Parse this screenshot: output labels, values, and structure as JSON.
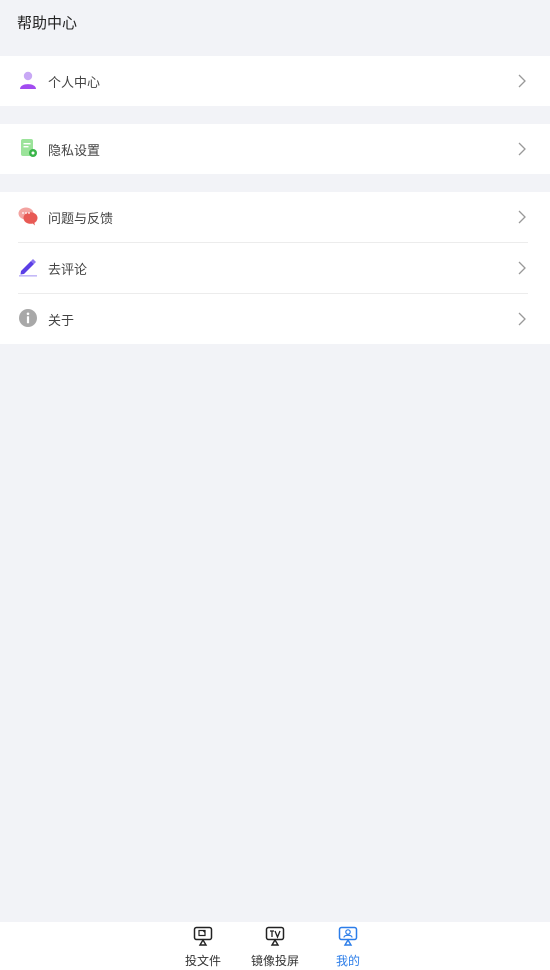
{
  "header": {
    "title": "帮助中心"
  },
  "groups": [
    {
      "items": [
        {
          "label": "个人中心",
          "icon": "person-icon"
        }
      ]
    },
    {
      "items": [
        {
          "label": "隐私设置",
          "icon": "privacy-doc-icon"
        }
      ]
    },
    {
      "items": [
        {
          "label": "问题与反馈",
          "icon": "chat-bubbles-icon"
        },
        {
          "label": "去评论",
          "icon": "pen-icon"
        },
        {
          "label": "关于",
          "icon": "info-icon"
        }
      ]
    }
  ],
  "tabbar": {
    "tabs": [
      {
        "label": "投文件",
        "icon": "cast-file-icon",
        "active": false
      },
      {
        "label": "镜像投屏",
        "icon": "screen-mirror-tv-icon",
        "active": false
      },
      {
        "label": "我的",
        "icon": "profile-cast-icon",
        "active": true
      }
    ]
  },
  "colors": {
    "background": "#f2f3f7",
    "accent": "#2b7de9",
    "card": "#ffffff"
  }
}
